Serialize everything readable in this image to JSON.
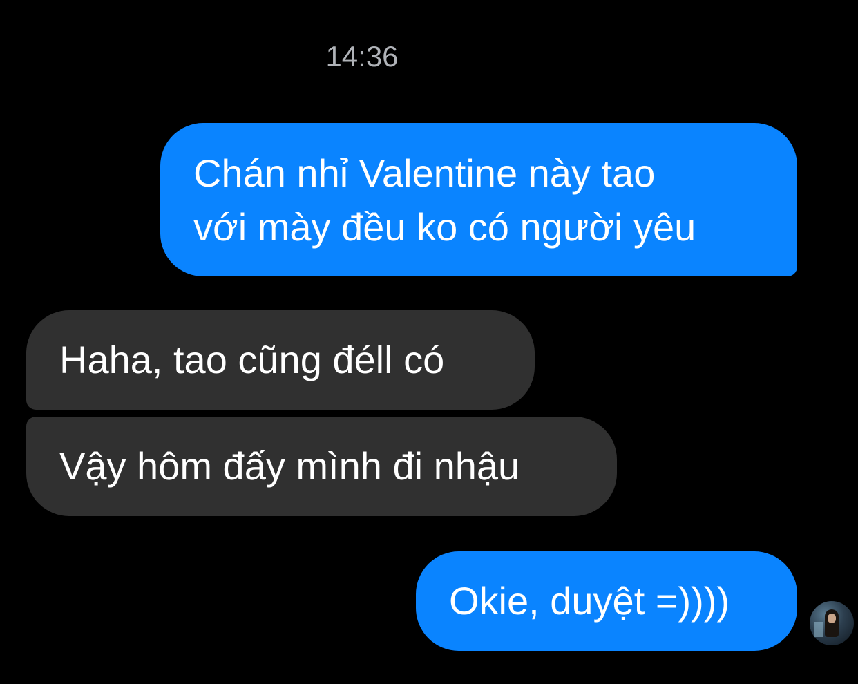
{
  "chat": {
    "timestamp": "14:36",
    "messages": [
      {
        "direction": "outgoing",
        "lines": [
          "Chán nhỉ Valentine này tao",
          "với mày đều ko có người yêu"
        ]
      },
      {
        "direction": "incoming",
        "text": "Haha, tao cũng đéll có"
      },
      {
        "direction": "incoming",
        "text": "Vậy hôm đấy mình đi nhậu"
      },
      {
        "direction": "outgoing",
        "text": "Okie, duyệt =))))"
      }
    ],
    "seen_avatar": "avatar-icon"
  },
  "colors": {
    "background": "#000000",
    "outgoing_bubble": "#0a84ff",
    "incoming_bubble": "#303030",
    "timestamp_text": "#b0b3b8",
    "message_text": "#ffffff"
  }
}
